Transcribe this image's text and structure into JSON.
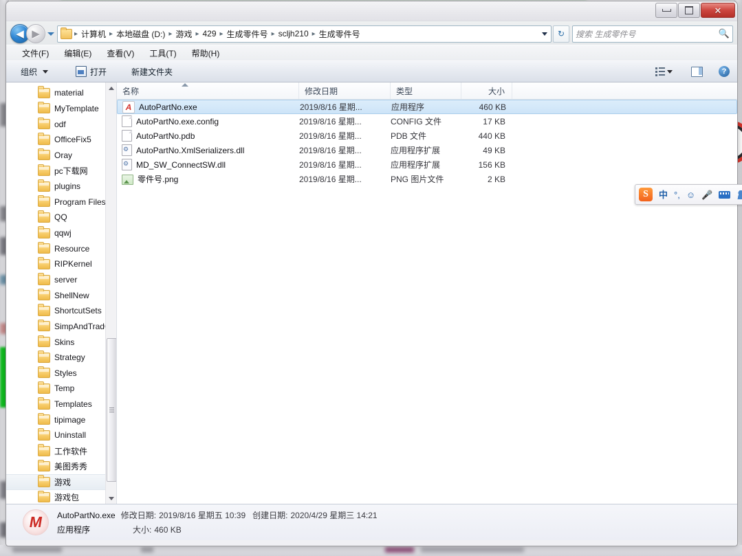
{
  "window": {
    "controls": {
      "minimize_label": "—",
      "maximize_label": "□",
      "close_label": "✕"
    }
  },
  "address_bar": {
    "back_label": "◀",
    "forward_label": "▶",
    "recent_pages_label": "▾",
    "folder_icon": "folder-icon",
    "breadcrumbs": [
      "计算机",
      "本地磁盘 (D:)",
      "游戏",
      "429",
      "生成零件号",
      "scljh210",
      "生成零件号"
    ],
    "separator": "▸",
    "dropdown_label": "▾",
    "refresh_label": "↻",
    "search_placeholder": "搜索 生成零件号",
    "search_value": "",
    "search_icon": "search-icon"
  },
  "menubar": {
    "items": [
      {
        "label": "文件(F)"
      },
      {
        "label": "编辑(E)"
      },
      {
        "label": "查看(V)"
      },
      {
        "label": "工具(T)"
      },
      {
        "label": "帮助(H)"
      }
    ]
  },
  "command_bar": {
    "organize_label": "组织",
    "open_label": "打开",
    "new_folder_label": "新建文件夹",
    "views_icon": "views-list-icon",
    "views_caret": "▾",
    "preview_pane_icon": "preview-pane-icon",
    "help_icon": "help-icon",
    "help_label": "?"
  },
  "nav_pane": {
    "items": [
      {
        "label": "material",
        "selected": false
      },
      {
        "label": "MyTemplate",
        "selected": false
      },
      {
        "label": "odf",
        "selected": false
      },
      {
        "label": "OfficeFix5",
        "selected": false
      },
      {
        "label": "Oray",
        "selected": false
      },
      {
        "label": "pc下载网",
        "selected": false
      },
      {
        "label": "plugins",
        "selected": false
      },
      {
        "label": "Program Files",
        "selected": false
      },
      {
        "label": "QQ",
        "selected": false
      },
      {
        "label": "qqwj",
        "selected": false
      },
      {
        "label": "Resource",
        "selected": false
      },
      {
        "label": "RIPKernel",
        "selected": false
      },
      {
        "label": "server",
        "selected": false
      },
      {
        "label": "ShellNew",
        "selected": false
      },
      {
        "label": "ShortcutSets",
        "selected": false
      },
      {
        "label": "SimpAndTradCo",
        "selected": false
      },
      {
        "label": "Skins",
        "selected": false
      },
      {
        "label": "Strategy",
        "selected": false
      },
      {
        "label": "Styles",
        "selected": false
      },
      {
        "label": "Temp",
        "selected": false
      },
      {
        "label": "Templates",
        "selected": false
      },
      {
        "label": "tipimage",
        "selected": false
      },
      {
        "label": "Uninstall",
        "selected": false
      },
      {
        "label": "工作软件",
        "selected": false
      },
      {
        "label": "美图秀秀",
        "selected": false
      },
      {
        "label": "游戏",
        "selected": true
      },
      {
        "label": "游戏包",
        "selected": false
      }
    ],
    "scroll_up_label": "▲",
    "scroll_down_label": "▼"
  },
  "file_list": {
    "columns": [
      {
        "label": "名称",
        "align": "left"
      },
      {
        "label": "修改日期",
        "align": "left"
      },
      {
        "label": "类型",
        "align": "left"
      },
      {
        "label": "大小",
        "align": "right"
      }
    ],
    "sort_column": "名称",
    "sort_direction": "asc",
    "rows": [
      {
        "name": "AutoPartNo.exe",
        "date": "2019/8/16 星期...",
        "type": "应用程序",
        "size": "460 KB",
        "icon": "exe",
        "selected": true
      },
      {
        "name": "AutoPartNo.exe.config",
        "date": "2019/8/16 星期...",
        "type": "CONFIG 文件",
        "size": "17 KB",
        "icon": "doc",
        "selected": false
      },
      {
        "name": "AutoPartNo.pdb",
        "date": "2019/8/16 星期...",
        "type": "PDB 文件",
        "size": "440 KB",
        "icon": "doc",
        "selected": false
      },
      {
        "name": "AutoPartNo.XmlSerializers.dll",
        "date": "2019/8/16 星期...",
        "type": "应用程序扩展",
        "size": "49 KB",
        "icon": "dll",
        "selected": false
      },
      {
        "name": "MD_SW_ConnectSW.dll",
        "date": "2019/8/16 星期...",
        "type": "应用程序扩展",
        "size": "156 KB",
        "icon": "dll",
        "selected": false
      },
      {
        "name": "零件号.png",
        "date": "2019/8/16 星期...",
        "type": "PNG 图片文件",
        "size": "2 KB",
        "icon": "png",
        "selected": false
      }
    ]
  },
  "details_pane": {
    "icon": "app-logo-icon",
    "icon_glyph": "M",
    "file_name": "AutoPartNo.exe",
    "modified_label": "修改日期:",
    "modified_value": "2019/8/16 星期五 10:39",
    "created_label": "创建日期:",
    "created_value": "2020/4/29 星期三 14:21",
    "file_type": "应用程序",
    "size_label": "大小:",
    "size_value": "460 KB"
  },
  "ime_toolbar": {
    "logo_label": "S",
    "mode_label": "中",
    "punctuation_label": "°,",
    "emoji_label": "☺",
    "voice_label": "🎤",
    "keyboard_icon": "keyboard-icon",
    "account_icon": "account-icon"
  },
  "colors": {
    "accent": "#2a6ea8",
    "selection": "#cde4f8",
    "selection_border": "#a9cdeb",
    "close_button": "#cd4740",
    "folder": "#f7cc6a",
    "ime_blue": "#1f5fa8",
    "exe_red": "#d32f2a"
  }
}
